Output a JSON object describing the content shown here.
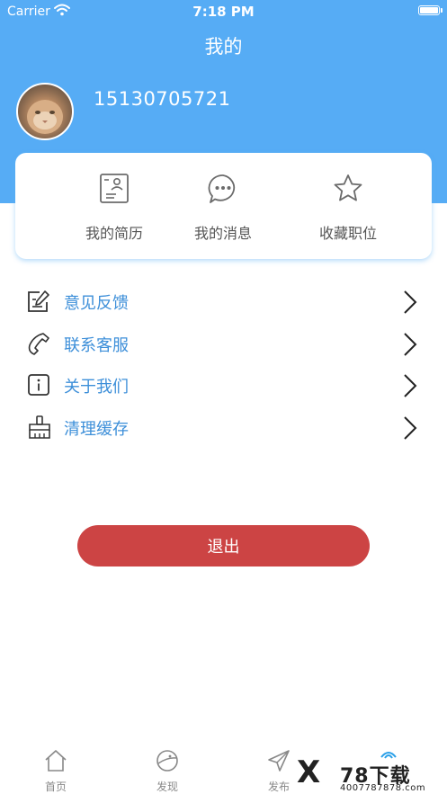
{
  "status_bar": {
    "carrier": "Carrier",
    "time": "7:18 PM"
  },
  "header": {
    "title": "我的"
  },
  "profile": {
    "phone": "15130705721"
  },
  "quick_actions": [
    {
      "label": "我的简历",
      "icon": "resume-icon"
    },
    {
      "label": "我的消息",
      "icon": "message-icon"
    },
    {
      "label": "收藏职位",
      "icon": "star-icon"
    }
  ],
  "menu": [
    {
      "label": "意见反馈",
      "icon": "feedback-icon"
    },
    {
      "label": "联系客服",
      "icon": "phone-icon"
    },
    {
      "label": "关于我们",
      "icon": "info-icon"
    },
    {
      "label": "清理缓存",
      "icon": "broom-icon"
    }
  ],
  "logout_label": "退出",
  "tabbar": [
    {
      "label": "首页",
      "icon": "home-icon"
    },
    {
      "label": "发现",
      "icon": "discover-icon"
    },
    {
      "label": "发布",
      "icon": "send-icon"
    }
  ],
  "watermark": {
    "title": "78下载",
    "site": "4007787878.com"
  },
  "colors": {
    "primary": "#56acf5",
    "menu_text": "#3d8fd9",
    "logout": "#cc4444"
  }
}
